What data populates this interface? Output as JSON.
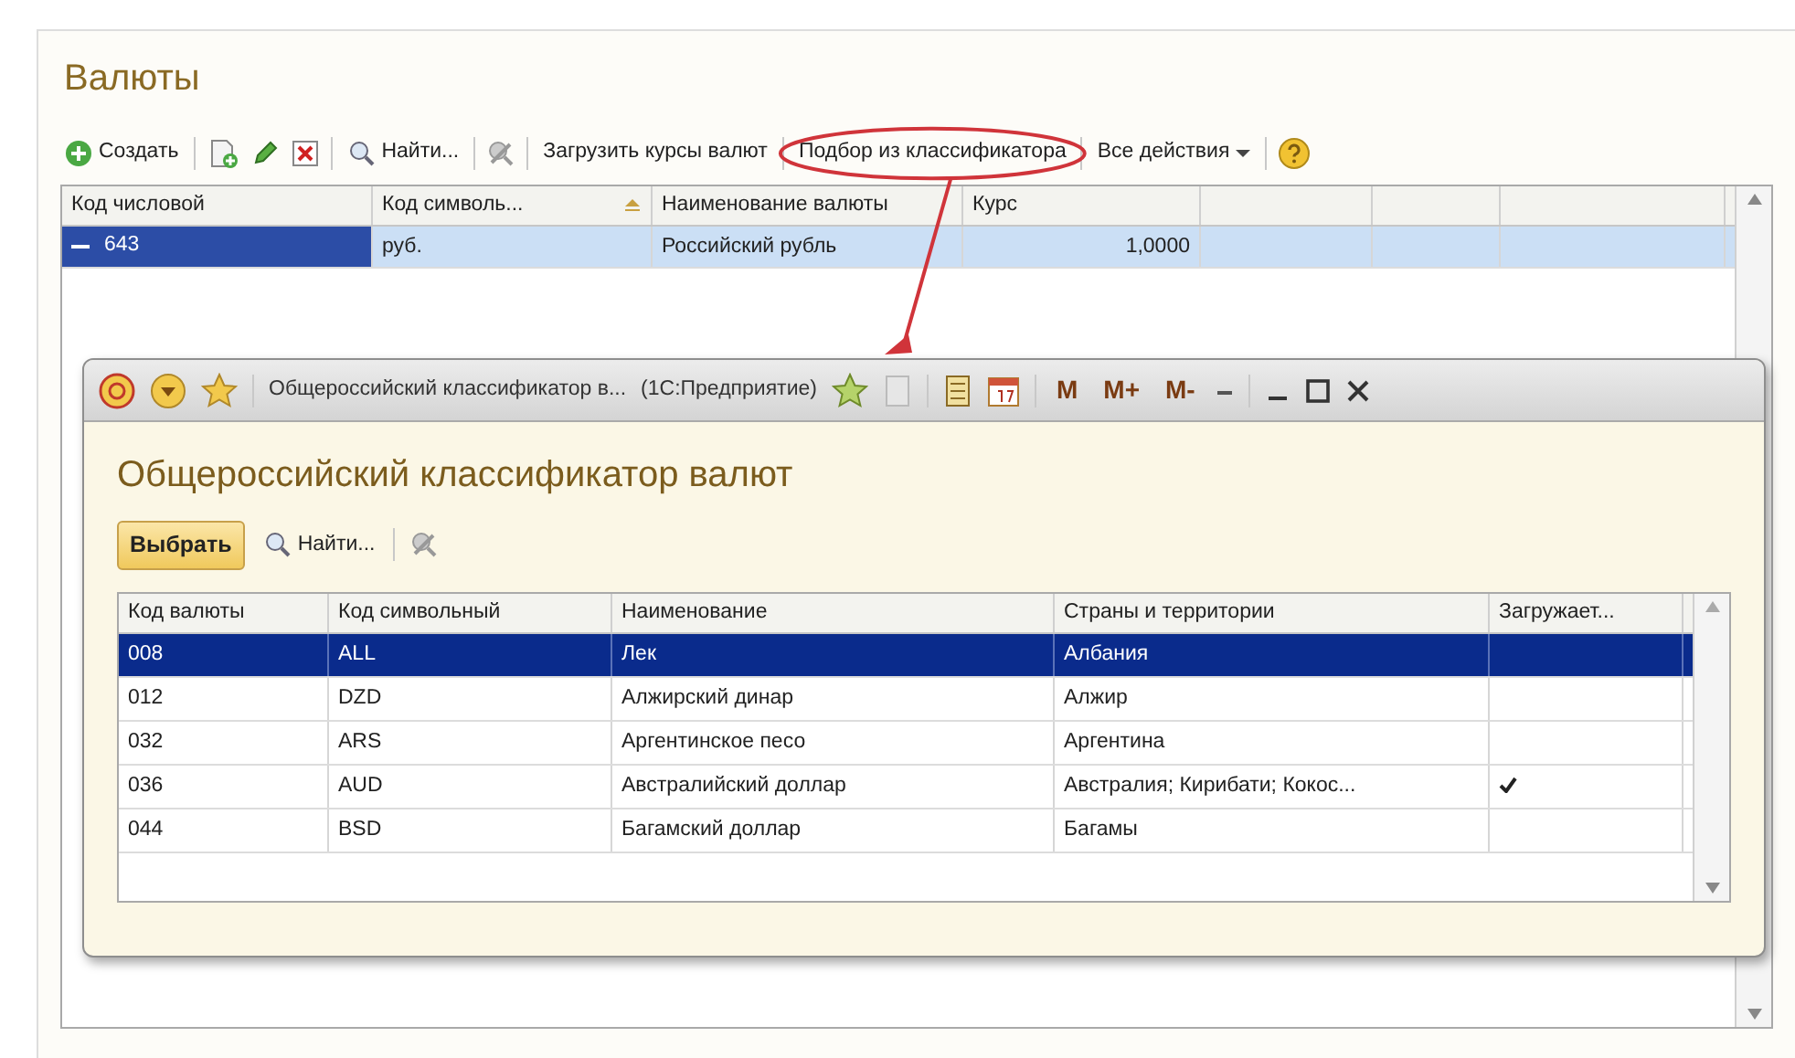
{
  "window": {
    "title": "Валюты"
  },
  "toolbar": {
    "create": "Создать",
    "find": "Найти...",
    "load_rates": "Загрузить курсы валют",
    "pick_from_classifier": "Подбор из классификатора",
    "all_actions": "Все действия"
  },
  "table": {
    "columns": [
      {
        "label": "Код числовой",
        "sorted": false
      },
      {
        "label": "Код символь...",
        "sorted": true
      },
      {
        "label": "Наименование валюты",
        "sorted": false
      },
      {
        "label": "Курс",
        "sorted": false
      }
    ],
    "rows": [
      {
        "cells": [
          "643",
          "руб.",
          "Российский рубль",
          "1,0000"
        ],
        "selected": true
      }
    ]
  },
  "dialog": {
    "title": "Общероссийский классификатор в...",
    "app": "(1С:Предприятие)",
    "memory_buttons": [
      "M",
      "M+",
      "M-"
    ],
    "heading": "Общероссийский классификатор валют",
    "select_button": "Выбрать",
    "find": "Найти...",
    "columns": [
      "Код валюты",
      "Код символьный",
      "Наименование",
      "Страны и территории",
      "Загружает..."
    ],
    "rows": [
      {
        "cells": [
          "008",
          "ALL",
          "Лек",
          "Албания"
        ],
        "loaded": false,
        "selected": true
      },
      {
        "cells": [
          "012",
          "DZD",
          "Алжирский динар",
          "Алжир"
        ],
        "loaded": false,
        "selected": false
      },
      {
        "cells": [
          "032",
          "ARS",
          "Аргентинское песо",
          "Аргентина"
        ],
        "loaded": false,
        "selected": false
      },
      {
        "cells": [
          "036",
          "AUD",
          "Австралийский доллар",
          "Австралия; Кирибати; Кокос..."
        ],
        "loaded": true,
        "selected": false
      },
      {
        "cells": [
          "044",
          "BSD",
          "Багамский доллар",
          "Багамы"
        ],
        "loaded": false,
        "selected": false
      }
    ]
  }
}
